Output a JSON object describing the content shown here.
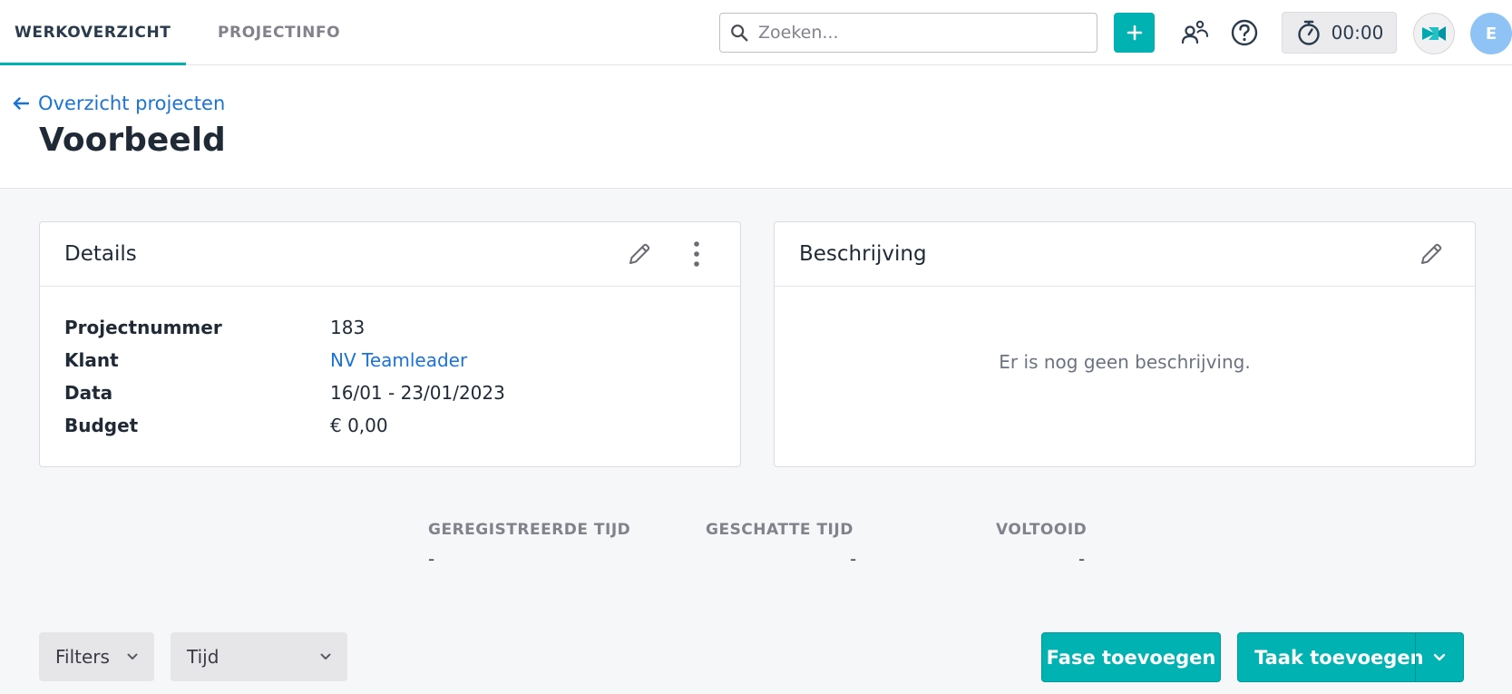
{
  "nav": {
    "tabs": [
      {
        "label": "WERKOVERZICHT",
        "active": true
      },
      {
        "label": "PROJECTINFO",
        "active": false
      }
    ],
    "search_placeholder": "Zoeken...",
    "timer": "00:00",
    "avatar_initial": "E"
  },
  "header": {
    "back_label": "Overzicht projecten",
    "title": "Voorbeeld"
  },
  "details": {
    "title": "Details",
    "rows": [
      {
        "label": "Projectnummer",
        "value": "183"
      },
      {
        "label": "Klant",
        "value": "NV Teamleader"
      },
      {
        "label": "Data",
        "value": "16/01 - 23/01/2023"
      },
      {
        "label": "Budget",
        "value": "€ 0,00"
      }
    ]
  },
  "description": {
    "title": "Beschrijving",
    "empty_text": "Er is nog geen beschrijving."
  },
  "stats": [
    {
      "label": "GEREGISTREERDE TIJD",
      "value": "-"
    },
    {
      "label": "GESCHATTE TIJD",
      "value": "-"
    },
    {
      "label": "VOLTOOID",
      "value": "-"
    }
  ],
  "toolbar": {
    "filters_label": "Filters",
    "group_label": "Tijd",
    "add_phase_label": "Fase toevoegen",
    "add_task_label": "Taak toevoegen"
  },
  "colors": {
    "accent": "#00b2b2",
    "link": "#1a73d9"
  }
}
